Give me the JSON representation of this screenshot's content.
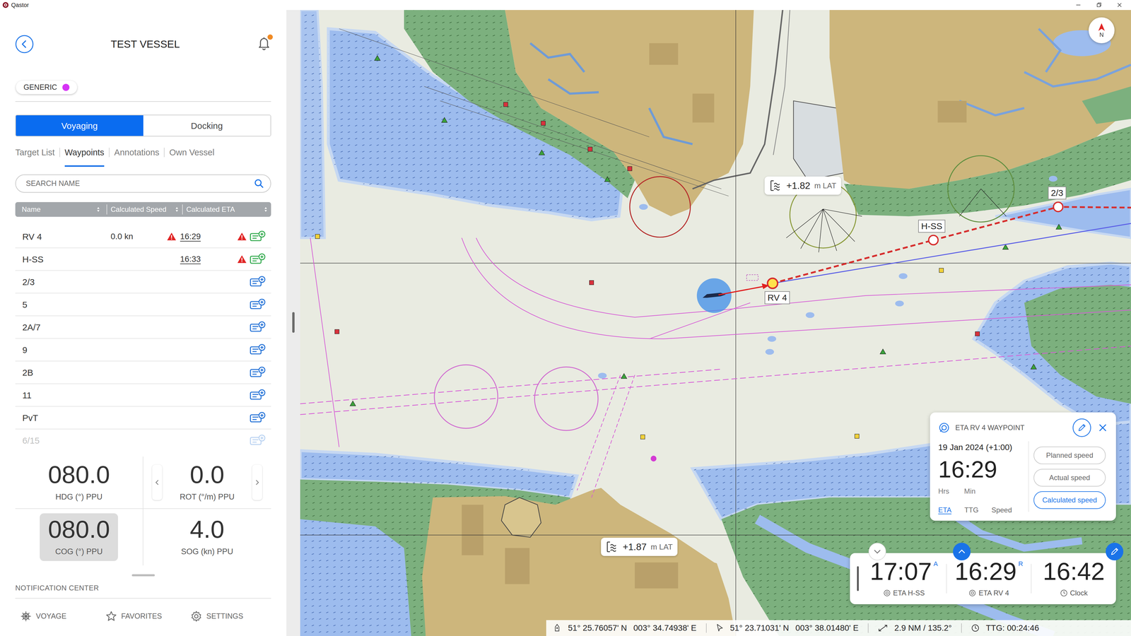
{
  "window": {
    "title": "Qastor"
  },
  "header": {
    "vessel": "TEST VESSEL",
    "unread": true,
    "profile": {
      "label": "GENERIC",
      "color": "#d633f5"
    }
  },
  "mode_tabs": [
    {
      "label": "Voyaging",
      "selected": true
    },
    {
      "label": "Docking",
      "selected": false
    }
  ],
  "sub_tabs": [
    {
      "label": "Target List",
      "selected": false
    },
    {
      "label": "Waypoints",
      "selected": true
    },
    {
      "label": "Annotations",
      "selected": false
    },
    {
      "label": "Own Vessel",
      "selected": false
    }
  ],
  "search": {
    "placeholder": "SEARCH NAME"
  },
  "table": {
    "columns": [
      "Name",
      "Calculated Speed",
      "Calculated ETA"
    ],
    "rows": [
      {
        "name": "RV 4",
        "speed": "0.0 kn",
        "speed_warning": true,
        "eta": "16:29",
        "eta_warning": true,
        "color": "#2ea84a",
        "faded": false
      },
      {
        "name": "H-SS",
        "speed_warning": false,
        "eta": "16:33",
        "eta_warning": true,
        "color": "#2ea84a",
        "faded": false
      },
      {
        "name": "2/3",
        "speed_warning": false,
        "eta_warning": false,
        "color": "#1f6fd6",
        "faded": false
      },
      {
        "name": "5",
        "speed_warning": false,
        "eta_warning": false,
        "color": "#1f6fd6",
        "faded": false
      },
      {
        "name": "2A/7",
        "speed_warning": false,
        "eta_warning": false,
        "color": "#1f6fd6",
        "faded": false
      },
      {
        "name": "9",
        "speed_warning": false,
        "eta_warning": false,
        "color": "#1f6fd6",
        "faded": false
      },
      {
        "name": "2B",
        "speed_warning": false,
        "eta_warning": false,
        "color": "#1f6fd6",
        "faded": false
      },
      {
        "name": "11",
        "speed_warning": false,
        "eta_warning": false,
        "color": "#1f6fd6",
        "faded": false
      },
      {
        "name": "PvT",
        "speed_warning": false,
        "eta_warning": false,
        "color": "#1f6fd6",
        "faded": false
      },
      {
        "name": "6/15",
        "speed_warning": false,
        "eta_warning": false,
        "color": "#1f6fd6",
        "faded": true
      }
    ]
  },
  "instruments": [
    {
      "value": "080.0",
      "label": "HDG (°) PPU",
      "selected": false
    },
    {
      "value": "0.0",
      "label": "ROT (°/m) PPU",
      "selected": false
    },
    {
      "value": "080.0",
      "label": "COG (°) PPU",
      "selected": true
    },
    {
      "value": "4.0",
      "label": "SOG (kn) PPU",
      "selected": false
    }
  ],
  "notification_center": {
    "title": "NOTIFICATION CENTER"
  },
  "bottom_nav": [
    {
      "label": "VOYAGE"
    },
    {
      "label": "FAVORITES"
    },
    {
      "label": "SETTINGS"
    }
  ],
  "map": {
    "north": {
      "label": "N"
    },
    "tides": [
      {
        "value": "+1.82",
        "unit": "m LAT"
      },
      {
        "value": "+1.87",
        "unit": "m LAT"
      }
    ],
    "waypoints": [
      {
        "label": "RV 4"
      },
      {
        "label": "H-SS"
      },
      {
        "label": "2/3"
      }
    ],
    "eta_card": {
      "title": "ETA RV 4 WAYPOINT",
      "date": "19 Jan 2024 (+1:00)",
      "time": "16:29",
      "units": [
        "Hrs",
        "Min"
      ],
      "tabs": [
        {
          "label": "ETA",
          "selected": true
        },
        {
          "label": "TTG",
          "selected": false
        },
        {
          "label": "Speed",
          "selected": false
        }
      ],
      "speed_options": [
        {
          "label": "Planned speed",
          "selected": false
        },
        {
          "label": "Actual speed",
          "selected": false
        },
        {
          "label": "Calculated speed",
          "selected": true
        }
      ]
    },
    "time_bar": {
      "items": [
        {
          "time": "17:07",
          "flag": "A",
          "label": "ETA H-SS",
          "kind": "eta"
        },
        {
          "time": "16:29",
          "flag": "R",
          "label": "ETA RV 4",
          "kind": "eta"
        },
        {
          "time": "16:42",
          "label": "Clock",
          "kind": "clock"
        }
      ]
    },
    "status_bar": {
      "own_lat": "51° 25.76057' N",
      "own_lon": "003° 34.74938' E",
      "cursor_lat": "51° 23.71031' N",
      "cursor_lon": "003° 38.01480' E",
      "range": "2.9 NM / 135.2°",
      "ttg": "TTG: 00:24:46"
    }
  }
}
